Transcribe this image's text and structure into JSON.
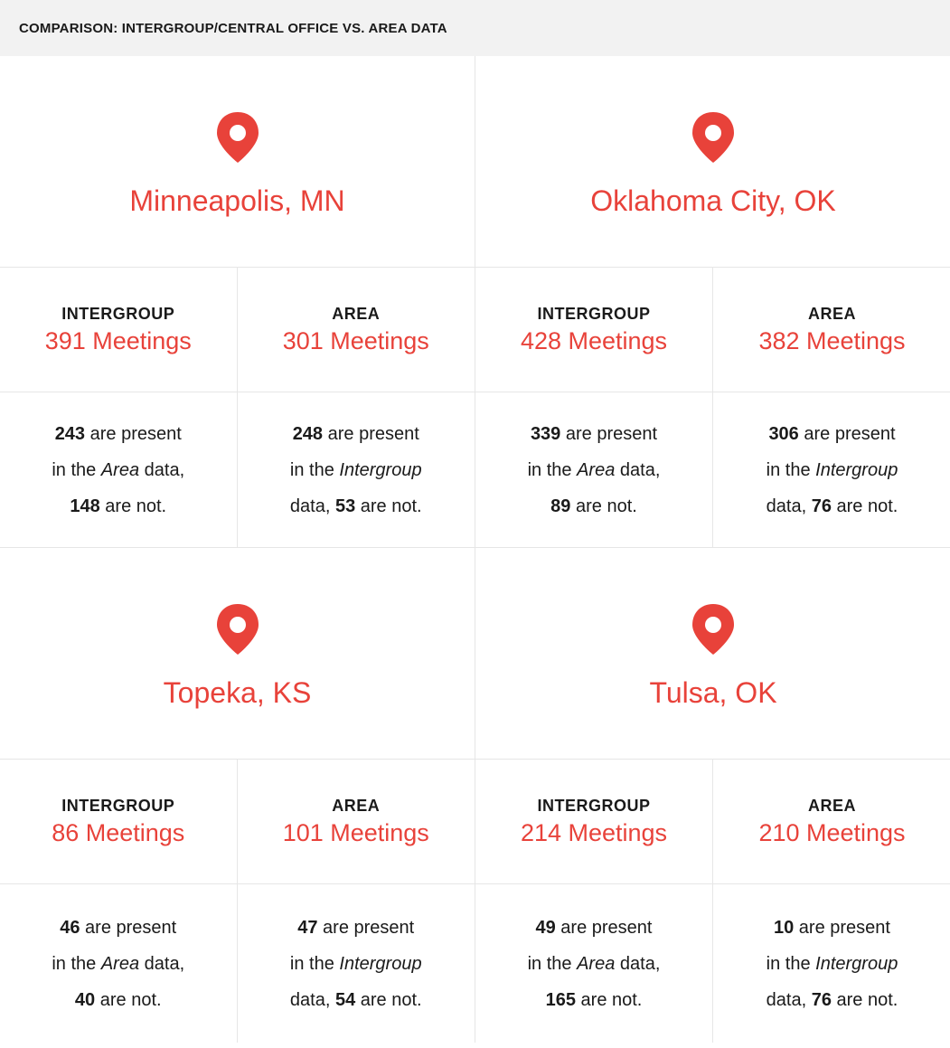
{
  "header": {
    "title": "COMPARISON: INTERGROUP/CENTRAL OFFICE VS. AREA DATA"
  },
  "colors": {
    "accent": "#e8423a",
    "header_bg": "#f2f2f2",
    "divider": "#e6e6e6"
  },
  "icons": {
    "pin": "map-pin-icon"
  },
  "labels": {
    "intergroup": "INTERGROUP",
    "area": "AREA"
  },
  "cities": [
    {
      "name": "Minneapolis, MN",
      "intergroup": {
        "meetings": "391 Meetings",
        "present": "243",
        "line1": " are present",
        "line2_pre": "in the ",
        "line2_em": "Area",
        "line2_post": " data,",
        "absent": "148",
        "line3_post": " are not."
      },
      "area": {
        "meetings": "301 Meetings",
        "present": "248",
        "line1": " are present",
        "line2_pre": "in the ",
        "line2_em": "Intergroup",
        "line3_pre": "data, ",
        "absent": "53",
        "line3_post": " are not."
      }
    },
    {
      "name": "Oklahoma City, OK",
      "intergroup": {
        "meetings": "428 Meetings",
        "present": "339",
        "line1": " are present",
        "line2_pre": "in the ",
        "line2_em": "Area",
        "line2_post": " data,",
        "absent": "89",
        "line3_post": " are not."
      },
      "area": {
        "meetings": "382 Meetings",
        "present": "306",
        "line1": " are present",
        "line2_pre": "in the ",
        "line2_em": "Intergroup",
        "line3_pre": "data, ",
        "absent": "76",
        "line3_post": " are not."
      }
    },
    {
      "name": "Topeka, KS",
      "intergroup": {
        "meetings": "86 Meetings",
        "present": "46",
        "line1": " are present",
        "line2_pre": "in the ",
        "line2_em": "Area",
        "line2_post": " data,",
        "absent": "40",
        "line3_post": " are not."
      },
      "area": {
        "meetings": "101 Meetings",
        "present": "47",
        "line1": " are present",
        "line2_pre": "in the ",
        "line2_em": "Intergroup",
        "line3_pre": "data, ",
        "absent": "54",
        "line3_post": " are not."
      }
    },
    {
      "name": "Tulsa, OK",
      "intergroup": {
        "meetings": "214 Meetings",
        "present": "49",
        "line1": " are present",
        "line2_pre": "in the ",
        "line2_em": "Area",
        "line2_post": " data,",
        "absent": "165",
        "line3_post": " are not."
      },
      "area": {
        "meetings": "210 Meetings",
        "present": "10",
        "line1": " are present",
        "line2_pre": "in the ",
        "line2_em": "Intergroup",
        "line3_pre": "data, ",
        "absent": "76",
        "line3_post": " are not."
      }
    }
  ]
}
